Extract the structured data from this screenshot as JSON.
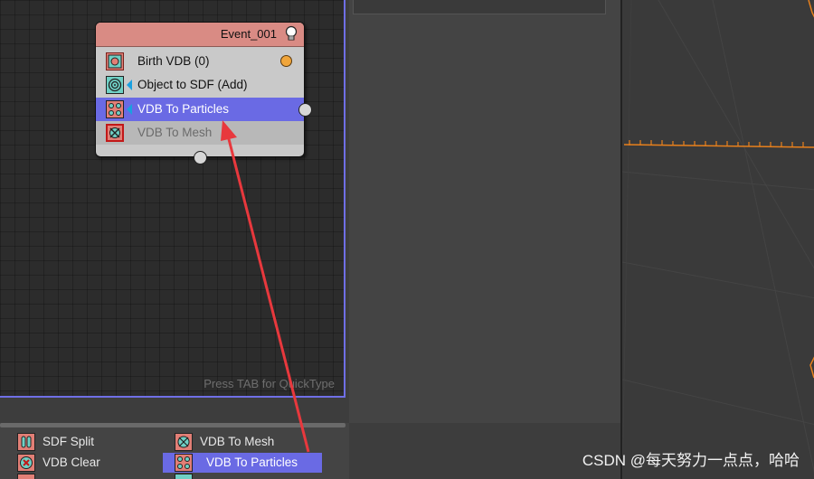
{
  "node": {
    "title": "Event_001",
    "operators": [
      {
        "label": "Birth VDB (0)",
        "icon": "birth-vdb-icon",
        "state": "normal"
      },
      {
        "label": "Object to SDF (Add)",
        "icon": "object-to-sdf-icon",
        "state": "normal"
      },
      {
        "label": "VDB To Particles",
        "icon": "vdb-to-particles-icon",
        "state": "selected"
      },
      {
        "label": "VDB To Mesh",
        "icon": "vdb-to-mesh-icon",
        "state": "disabled"
      }
    ]
  },
  "canvas": {
    "hint": "Press TAB for QuickType"
  },
  "depot": {
    "col1": [
      {
        "label": "SDF Split",
        "icon": "sdf-split-icon"
      },
      {
        "label": "VDB Clear",
        "icon": "vdb-clear-icon"
      }
    ],
    "col2": [
      {
        "label": "VDB To Mesh",
        "icon": "vdb-to-mesh-icon"
      },
      {
        "label": "VDB To Particles",
        "icon": "vdb-to-particles-icon",
        "selected": true
      }
    ]
  },
  "watermark": "CSDN @每天努力一点点，哈哈",
  "colors": {
    "accent_selection": "#6a6ae4",
    "node_header": "#d98b84",
    "annotation_arrow": "#e8383d",
    "viewport_grid": "#e8801c"
  }
}
